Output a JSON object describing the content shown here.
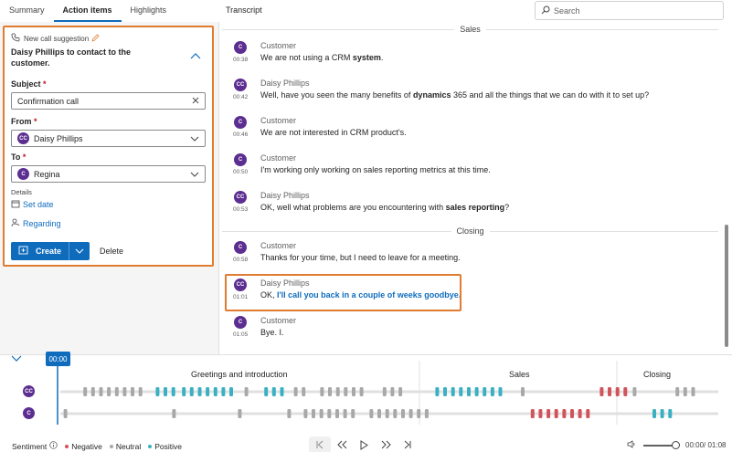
{
  "tabs": [
    {
      "label": "Summary",
      "active": false
    },
    {
      "label": "Action items",
      "active": true
    },
    {
      "label": "Highlights",
      "active": false
    }
  ],
  "transcript_title": "Transcript",
  "search": {
    "placeholder": "Search"
  },
  "suggestion": {
    "header": "New call suggestion",
    "title": "Daisy Phillips to contact to the customer.",
    "subject_label": "Subject",
    "subject_value": "Confirmation call",
    "from_label": "From",
    "from_value": "Daisy Phillips",
    "from_initials": "CC",
    "to_label": "To",
    "to_value": "Regina",
    "to_initials": "C",
    "details_label": "Details",
    "set_date": "Set date",
    "regarding": "Regarding",
    "create": "Create",
    "delete": "Delete",
    "required_mark": "*"
  },
  "sections": {
    "sales": "Sales",
    "closing": "Closing"
  },
  "messages": [
    {
      "initials": "C",
      "speaker": "Customer",
      "time": "00:38",
      "parts": [
        {
          "t": "We are not using a CRM "
        },
        {
          "t": "system",
          "b": true
        },
        {
          "t": "."
        }
      ]
    },
    {
      "initials": "CC",
      "speaker": "Daisy Phillips",
      "time": "00:42",
      "parts": [
        {
          "t": "Well, have you seen the many benefits of "
        },
        {
          "t": "dynamics",
          "b": true
        },
        {
          "t": " 365 and all the things that we can do with it to set up?"
        }
      ]
    },
    {
      "initials": "C",
      "speaker": "Customer",
      "time": "00:46",
      "parts": [
        {
          "t": "We are not interested in CRM product's."
        }
      ]
    },
    {
      "initials": "C",
      "speaker": "Customer",
      "time": "00:50",
      "parts": [
        {
          "t": "I'm working only working on sales reporting metrics at this time."
        }
      ]
    },
    {
      "initials": "CC",
      "speaker": "Daisy Phillips",
      "time": "00:53",
      "parts": [
        {
          "t": "OK, well what problems are you encountering with "
        },
        {
          "t": "sales reporting",
          "b": true
        },
        {
          "t": "?"
        }
      ]
    },
    {
      "initials": "C",
      "speaker": "Customer",
      "time": "00:58",
      "parts": [
        {
          "t": "Thanks for your time, but I need to leave for a meeting."
        }
      ]
    },
    {
      "initials": "CC",
      "speaker": "Daisy Phillips",
      "time": "01:01",
      "parts": [
        {
          "t": "OK, "
        },
        {
          "t": "I'll call you back in a couple of weeks goodbye.",
          "hl": true
        }
      ]
    },
    {
      "initials": "C",
      "speaker": "Customer",
      "time": "01:05",
      "parts": [
        {
          "t": "Bye. I."
        }
      ]
    }
  ],
  "timeline": {
    "current_time": "00:00",
    "segments": [
      "Greetings and introduction",
      "Sales",
      "Closing"
    ],
    "rows": [
      {
        "initials": "CC"
      },
      {
        "initials": "C"
      }
    ],
    "rows_marks": [
      [
        {
          "s": "n",
          "a": 0.035
        },
        {
          "s": "n",
          "a": 0.047
        },
        {
          "s": "n",
          "a": 0.059
        },
        {
          "s": "n",
          "a": 0.071
        },
        {
          "s": "n",
          "a": 0.083
        },
        {
          "s": "n",
          "a": 0.095
        },
        {
          "s": "n",
          "a": 0.107
        },
        {
          "s": "n",
          "a": 0.119
        },
        {
          "s": "p",
          "a": 0.145
        },
        {
          "s": "p",
          "a": 0.157
        },
        {
          "s": "p",
          "a": 0.169
        },
        {
          "s": "p",
          "a": 0.185
        },
        {
          "s": "p",
          "a": 0.197
        },
        {
          "s": "p",
          "a": 0.209
        },
        {
          "s": "p",
          "a": 0.221
        },
        {
          "s": "p",
          "a": 0.233
        },
        {
          "s": "p",
          "a": 0.245
        },
        {
          "s": "p",
          "a": 0.257
        },
        {
          "s": "n",
          "a": 0.28
        },
        {
          "s": "p",
          "a": 0.31
        },
        {
          "s": "p",
          "a": 0.322
        },
        {
          "s": "p",
          "a": 0.334
        },
        {
          "s": "n",
          "a": 0.355
        },
        {
          "s": "n",
          "a": 0.367
        },
        {
          "s": "n",
          "a": 0.395
        },
        {
          "s": "n",
          "a": 0.407
        },
        {
          "s": "n",
          "a": 0.419
        },
        {
          "s": "n",
          "a": 0.431
        },
        {
          "s": "n",
          "a": 0.443
        },
        {
          "s": "n",
          "a": 0.455
        },
        {
          "s": "n",
          "a": 0.49
        },
        {
          "s": "n",
          "a": 0.502
        },
        {
          "s": "n",
          "a": 0.514
        },
        {
          "s": "p",
          "a": 0.57
        },
        {
          "s": "p",
          "a": 0.582
        },
        {
          "s": "p",
          "a": 0.594
        },
        {
          "s": "p",
          "a": 0.606
        },
        {
          "s": "p",
          "a": 0.618
        },
        {
          "s": "p",
          "a": 0.63
        },
        {
          "s": "p",
          "a": 0.642
        },
        {
          "s": "p",
          "a": 0.654
        },
        {
          "s": "p",
          "a": 0.666
        },
        {
          "s": "n",
          "a": 0.7
        },
        {
          "s": "ng",
          "a": 0.82
        },
        {
          "s": "ng",
          "a": 0.832
        },
        {
          "s": "ng",
          "a": 0.844
        },
        {
          "s": "ng",
          "a": 0.856
        },
        {
          "s": "n",
          "a": 0.87
        },
        {
          "s": "n",
          "a": 0.935
        },
        {
          "s": "n",
          "a": 0.947
        },
        {
          "s": "n",
          "a": 0.959
        }
      ],
      [
        {
          "s": "n",
          "a": 0.005
        },
        {
          "s": "n",
          "a": 0.17
        },
        {
          "s": "n",
          "a": 0.27
        },
        {
          "s": "n",
          "a": 0.345
        },
        {
          "s": "n",
          "a": 0.37
        },
        {
          "s": "n",
          "a": 0.382
        },
        {
          "s": "n",
          "a": 0.394
        },
        {
          "s": "n",
          "a": 0.406
        },
        {
          "s": "n",
          "a": 0.418
        },
        {
          "s": "n",
          "a": 0.43
        },
        {
          "s": "n",
          "a": 0.442
        },
        {
          "s": "n",
          "a": 0.47
        },
        {
          "s": "n",
          "a": 0.482
        },
        {
          "s": "n",
          "a": 0.494
        },
        {
          "s": "n",
          "a": 0.506
        },
        {
          "s": "n",
          "a": 0.518
        },
        {
          "s": "n",
          "a": 0.53
        },
        {
          "s": "n",
          "a": 0.542
        },
        {
          "s": "n",
          "a": 0.554
        },
        {
          "s": "ng",
          "a": 0.715
        },
        {
          "s": "ng",
          "a": 0.727
        },
        {
          "s": "ng",
          "a": 0.739
        },
        {
          "s": "ng",
          "a": 0.751
        },
        {
          "s": "ng",
          "a": 0.763
        },
        {
          "s": "ng",
          "a": 0.775
        },
        {
          "s": "ng",
          "a": 0.787
        },
        {
          "s": "ng",
          "a": 0.799
        },
        {
          "s": "p",
          "a": 0.9
        },
        {
          "s": "p",
          "a": 0.912
        },
        {
          "s": "p",
          "a": 0.924
        }
      ]
    ]
  },
  "legend": {
    "label": "Sentiment",
    "negative": "Negative",
    "neutral": "Neutral",
    "positive": "Positive"
  },
  "colors": {
    "negative": "#d1545a",
    "neutral": "#a8a8a8",
    "positive": "#3ab0c3",
    "accent": "#0f6cbd",
    "avatar": "#5c2e91",
    "highlight": "#e07c30"
  },
  "player": {
    "time": "00:00/ 01:08",
    "volume_level": 1.0
  }
}
